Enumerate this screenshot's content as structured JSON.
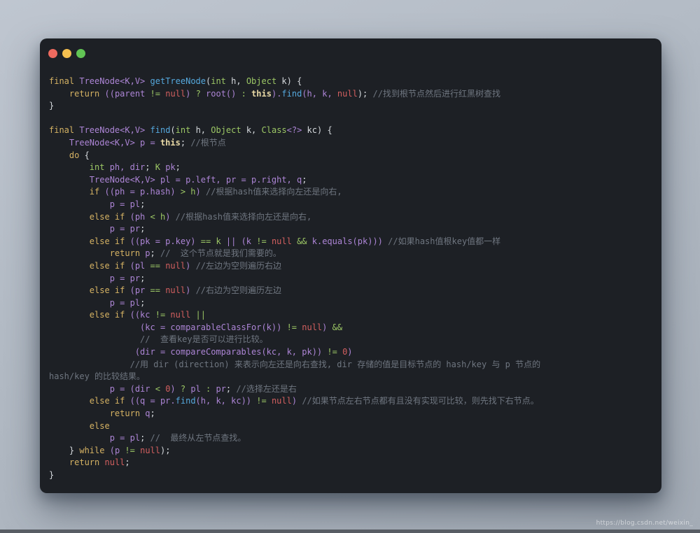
{
  "page": {
    "background_top": "#bfc6d0",
    "background_bottom": "#a4acb6",
    "bottom_bar_color": "#585d64",
    "watermark": "https://blog.csdn.net/weixin_"
  },
  "window": {
    "background": "#1d2025",
    "traffic_lights": [
      {
        "name": "close-button",
        "color": "#ee6a5f"
      },
      {
        "name": "minimize-button",
        "color": "#f5bf4f"
      },
      {
        "name": "zoom-button",
        "color": "#61c454"
      }
    ]
  },
  "colors": {
    "kw": "#d5b263",
    "id": "#ad85d6",
    "fn": "#55a8dd",
    "ty": "#9cc765",
    "op": "#9cc765",
    "num": "#d25f5f",
    "th": "#e9d9a6",
    "pl": "#d6dade",
    "cm": "#6f7680"
  },
  "code": {
    "language": "java",
    "lines": [
      [
        {
          "c": "kw",
          "t": "final"
        },
        {
          "c": "pl",
          "t": " "
        },
        {
          "c": "id",
          "t": "TreeNode<K,V>"
        },
        {
          "c": "pl",
          "t": " "
        },
        {
          "c": "fn",
          "t": "getTreeNode"
        },
        {
          "c": "pl",
          "t": "("
        },
        {
          "c": "ty",
          "t": "int"
        },
        {
          "c": "pl",
          "t": " h, "
        },
        {
          "c": "ty",
          "t": "Object"
        },
        {
          "c": "pl",
          "t": " k) {"
        }
      ],
      [
        {
          "c": "pl",
          "t": "    "
        },
        {
          "c": "kw",
          "t": "return"
        },
        {
          "c": "pl",
          "t": " "
        },
        {
          "c": "id",
          "t": "((parent "
        },
        {
          "c": "op",
          "t": "!= "
        },
        {
          "c": "num",
          "t": "null"
        },
        {
          "c": "id",
          "t": ") "
        },
        {
          "c": "op",
          "t": "? "
        },
        {
          "c": "id",
          "t": "root() "
        },
        {
          "c": "op",
          "t": ": "
        },
        {
          "c": "th",
          "t": "this"
        },
        {
          "c": "id",
          "t": ")."
        },
        {
          "c": "fn",
          "t": "find"
        },
        {
          "c": "id",
          "t": "(h, k, "
        },
        {
          "c": "num",
          "t": "null"
        },
        {
          "c": "pl",
          "t": "); "
        },
        {
          "c": "cm",
          "t": "//找到根节点然后进行红黑树查找"
        }
      ],
      [
        {
          "c": "pl",
          "t": "}"
        }
      ],
      [],
      [
        {
          "c": "kw",
          "t": "final"
        },
        {
          "c": "pl",
          "t": " "
        },
        {
          "c": "id",
          "t": "TreeNode<K,V>"
        },
        {
          "c": "pl",
          "t": " "
        },
        {
          "c": "fn",
          "t": "find"
        },
        {
          "c": "pl",
          "t": "("
        },
        {
          "c": "ty",
          "t": "int"
        },
        {
          "c": "pl",
          "t": " h, "
        },
        {
          "c": "ty",
          "t": "Object"
        },
        {
          "c": "pl",
          "t": " k, "
        },
        {
          "c": "ty",
          "t": "Class"
        },
        {
          "c": "id",
          "t": "<?>"
        },
        {
          "c": "pl",
          "t": " kc) {"
        }
      ],
      [
        {
          "c": "pl",
          "t": "    "
        },
        {
          "c": "id",
          "t": "TreeNode<K,V> p = "
        },
        {
          "c": "th",
          "t": "this"
        },
        {
          "c": "pl",
          "t": "; "
        },
        {
          "c": "cm",
          "t": "//根节点"
        }
      ],
      [
        {
          "c": "pl",
          "t": "    "
        },
        {
          "c": "kw",
          "t": "do"
        },
        {
          "c": "pl",
          "t": " {"
        }
      ],
      [
        {
          "c": "pl",
          "t": "        "
        },
        {
          "c": "ty",
          "t": "int"
        },
        {
          "c": "id",
          "t": " ph, dir"
        },
        {
          "c": "pl",
          "t": "; "
        },
        {
          "c": "ty",
          "t": "K"
        },
        {
          "c": "id",
          "t": " pk"
        },
        {
          "c": "pl",
          "t": ";"
        }
      ],
      [
        {
          "c": "pl",
          "t": "        "
        },
        {
          "c": "id",
          "t": "TreeNode<K,V> pl = p.left, pr = p.right, q"
        },
        {
          "c": "pl",
          "t": ";"
        }
      ],
      [
        {
          "c": "pl",
          "t": "        "
        },
        {
          "c": "kw",
          "t": "if"
        },
        {
          "c": "pl",
          "t": " "
        },
        {
          "c": "id",
          "t": "((ph = p.hash) "
        },
        {
          "c": "op",
          "t": "> h"
        },
        {
          "c": "id",
          "t": ")"
        },
        {
          "c": "pl",
          "t": " "
        },
        {
          "c": "cm",
          "t": "//根据hash值来选择向左还是向右,"
        }
      ],
      [
        {
          "c": "pl",
          "t": "            "
        },
        {
          "c": "id",
          "t": "p = pl"
        },
        {
          "c": "pl",
          "t": ";"
        }
      ],
      [
        {
          "c": "pl",
          "t": "        "
        },
        {
          "c": "kw",
          "t": "else if"
        },
        {
          "c": "pl",
          "t": " "
        },
        {
          "c": "id",
          "t": "(ph "
        },
        {
          "c": "op",
          "t": "< h"
        },
        {
          "c": "id",
          "t": ")"
        },
        {
          "c": "pl",
          "t": " "
        },
        {
          "c": "cm",
          "t": "//根据hash值来选择向左还是向右,"
        }
      ],
      [
        {
          "c": "pl",
          "t": "            "
        },
        {
          "c": "id",
          "t": "p = pr"
        },
        {
          "c": "pl",
          "t": ";"
        }
      ],
      [
        {
          "c": "pl",
          "t": "        "
        },
        {
          "c": "kw",
          "t": "else if"
        },
        {
          "c": "pl",
          "t": " "
        },
        {
          "c": "id",
          "t": "((pk = p.key) "
        },
        {
          "c": "op",
          "t": "== k "
        },
        {
          "c": "id",
          "t": "|| (k "
        },
        {
          "c": "op",
          "t": "!= "
        },
        {
          "c": "num",
          "t": "null"
        },
        {
          "c": "op",
          "t": " && "
        },
        {
          "c": "id",
          "t": "k.equals(pk)))"
        },
        {
          "c": "pl",
          "t": " "
        },
        {
          "c": "cm",
          "t": "//如果hash值根key值都一样"
        }
      ],
      [
        {
          "c": "pl",
          "t": "            "
        },
        {
          "c": "kw",
          "t": "return"
        },
        {
          "c": "id",
          "t": " p"
        },
        {
          "c": "pl",
          "t": "; "
        },
        {
          "c": "cm",
          "t": "//  这个节点就是我们需要的。"
        }
      ],
      [
        {
          "c": "pl",
          "t": "        "
        },
        {
          "c": "kw",
          "t": "else if"
        },
        {
          "c": "pl",
          "t": " "
        },
        {
          "c": "id",
          "t": "(pl "
        },
        {
          "c": "op",
          "t": "== "
        },
        {
          "c": "num",
          "t": "null"
        },
        {
          "c": "id",
          "t": ")"
        },
        {
          "c": "pl",
          "t": " "
        },
        {
          "c": "cm",
          "t": "//左边为空则遍历右边"
        }
      ],
      [
        {
          "c": "pl",
          "t": "            "
        },
        {
          "c": "id",
          "t": "p = pr"
        },
        {
          "c": "pl",
          "t": ";"
        }
      ],
      [
        {
          "c": "pl",
          "t": "        "
        },
        {
          "c": "kw",
          "t": "else if"
        },
        {
          "c": "pl",
          "t": " "
        },
        {
          "c": "id",
          "t": "(pr "
        },
        {
          "c": "op",
          "t": "== "
        },
        {
          "c": "num",
          "t": "null"
        },
        {
          "c": "id",
          "t": ")"
        },
        {
          "c": "pl",
          "t": " "
        },
        {
          "c": "cm",
          "t": "//右边为空则遍历左边"
        }
      ],
      [
        {
          "c": "pl",
          "t": "            "
        },
        {
          "c": "id",
          "t": "p = pl"
        },
        {
          "c": "pl",
          "t": ";"
        }
      ],
      [
        {
          "c": "pl",
          "t": "        "
        },
        {
          "c": "kw",
          "t": "else if"
        },
        {
          "c": "pl",
          "t": " "
        },
        {
          "c": "id",
          "t": "((kc "
        },
        {
          "c": "op",
          "t": "!= "
        },
        {
          "c": "num",
          "t": "null"
        },
        {
          "c": "op",
          "t": " ||"
        }
      ],
      [
        {
          "c": "pl",
          "t": "                  "
        },
        {
          "c": "id",
          "t": "(kc = comparableClassFor(k)) "
        },
        {
          "c": "op",
          "t": "!= "
        },
        {
          "c": "num",
          "t": "null"
        },
        {
          "c": "id",
          "t": ") "
        },
        {
          "c": "op",
          "t": "&&"
        }
      ],
      [
        {
          "c": "pl",
          "t": "                  "
        },
        {
          "c": "cm",
          "t": "//  查看key是否可以进行比较。"
        }
      ],
      [
        {
          "c": "pl",
          "t": "                 "
        },
        {
          "c": "id",
          "t": "(dir = compareComparables(kc, k, pk)) "
        },
        {
          "c": "op",
          "t": "!= "
        },
        {
          "c": "num",
          "t": "0"
        },
        {
          "c": "id",
          "t": ")"
        }
      ],
      [
        {
          "c": "pl",
          "t": "                "
        },
        {
          "c": "cm",
          "t": "//用 dir (direction) 来表示向左还是向右查找, dir 存储的值是目标节点的 hash/key 与 p 节点的"
        }
      ],
      [
        {
          "c": "cm",
          "t": "hash/key 的比较结果。"
        }
      ],
      [
        {
          "c": "pl",
          "t": "            "
        },
        {
          "c": "id",
          "t": "p = (dir "
        },
        {
          "c": "op",
          "t": "< "
        },
        {
          "c": "num",
          "t": "0"
        },
        {
          "c": "id",
          "t": ") "
        },
        {
          "c": "op",
          "t": "? "
        },
        {
          "c": "id",
          "t": "pl "
        },
        {
          "c": "op",
          "t": ": "
        },
        {
          "c": "id",
          "t": "pr"
        },
        {
          "c": "pl",
          "t": "; "
        },
        {
          "c": "cm",
          "t": "//选择左还是右"
        }
      ],
      [
        {
          "c": "pl",
          "t": "        "
        },
        {
          "c": "kw",
          "t": "else if"
        },
        {
          "c": "pl",
          "t": " "
        },
        {
          "c": "id",
          "t": "((q = pr."
        },
        {
          "c": "fn",
          "t": "find"
        },
        {
          "c": "id",
          "t": "(h, k, kc)) "
        },
        {
          "c": "op",
          "t": "!= "
        },
        {
          "c": "num",
          "t": "null"
        },
        {
          "c": "id",
          "t": ")"
        },
        {
          "c": "pl",
          "t": " "
        },
        {
          "c": "cm",
          "t": "//如果节点左右节点都有且没有实现可比较，则先找下右节点。"
        }
      ],
      [
        {
          "c": "pl",
          "t": "            "
        },
        {
          "c": "kw",
          "t": "return"
        },
        {
          "c": "id",
          "t": " q"
        },
        {
          "c": "pl",
          "t": ";"
        }
      ],
      [
        {
          "c": "pl",
          "t": "        "
        },
        {
          "c": "kw",
          "t": "else"
        }
      ],
      [
        {
          "c": "pl",
          "t": "            "
        },
        {
          "c": "id",
          "t": "p = pl"
        },
        {
          "c": "pl",
          "t": "; "
        },
        {
          "c": "cm",
          "t": "//  最终从左节点查找。"
        }
      ],
      [
        {
          "c": "pl",
          "t": "    } "
        },
        {
          "c": "kw",
          "t": "while"
        },
        {
          "c": "pl",
          "t": " "
        },
        {
          "c": "id",
          "t": "(p "
        },
        {
          "c": "op",
          "t": "!= "
        },
        {
          "c": "num",
          "t": "null"
        },
        {
          "c": "pl",
          "t": ");"
        }
      ],
      [
        {
          "c": "pl",
          "t": "    "
        },
        {
          "c": "kw",
          "t": "return"
        },
        {
          "c": "pl",
          "t": " "
        },
        {
          "c": "num",
          "t": "null"
        },
        {
          "c": "pl",
          "t": ";"
        }
      ],
      [
        {
          "c": "pl",
          "t": "}"
        }
      ]
    ]
  }
}
